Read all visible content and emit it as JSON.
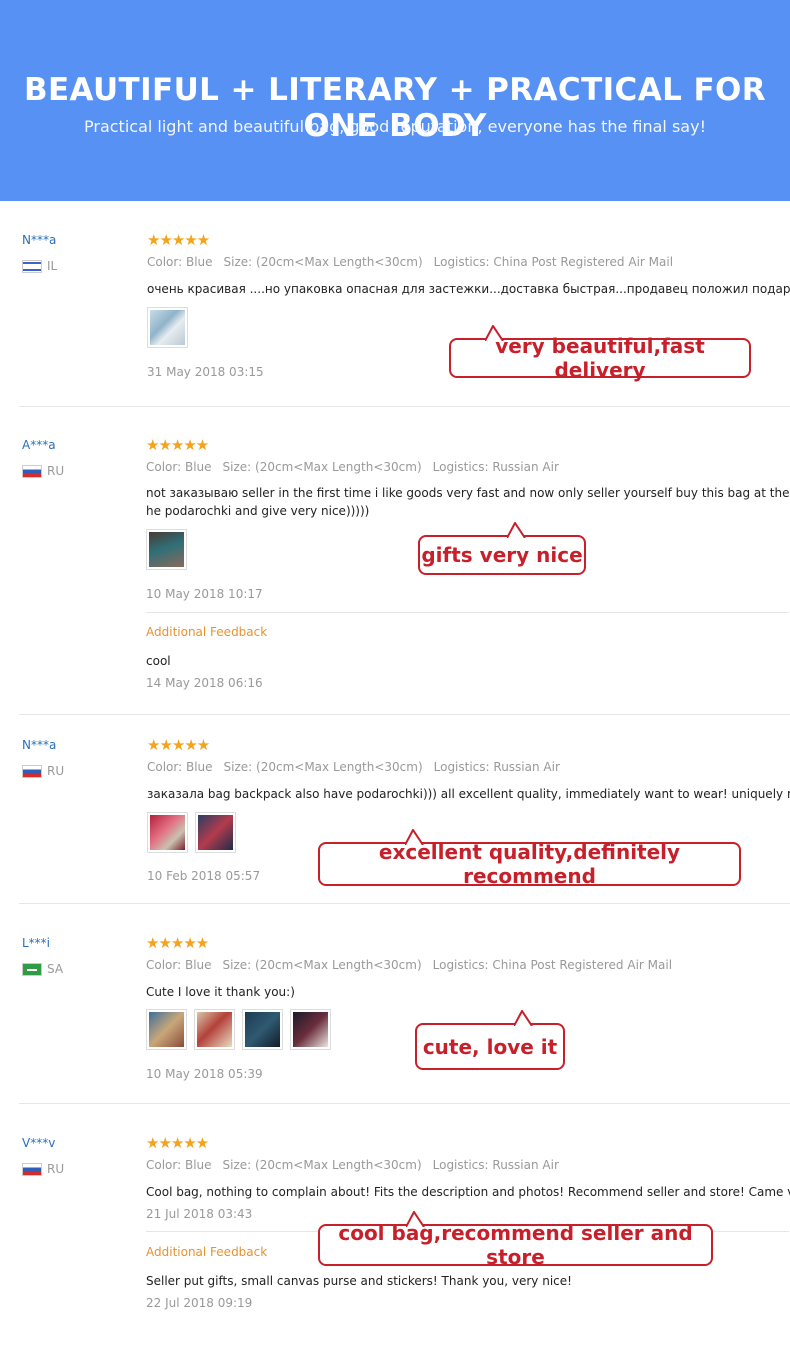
{
  "banner": {
    "title": "BEAUTIFUL + LITERARY + PRACTICAL FOR ONE BODY",
    "subtitle": "Practical light and beautiful bag, good reputation, everyone has the final say!"
  },
  "reviews": [
    {
      "user": "N***a",
      "country": "IL",
      "stars": "★★★★★",
      "color": "Color: Blue",
      "size": "Size: (20cm<Max Length<30cm)",
      "logistics": "Logistics: China Post Registered Air Mail",
      "text": "очень красивая ....но упаковка опасная для застежки...доставка быстрая...продавец положил подарочек",
      "date": "31 May 2018 03:15",
      "callout": "very beautiful,fast delivery"
    },
    {
      "user": "A***a",
      "country": "RU",
      "stars": "★★★★★",
      "color": "Color: Blue",
      "size": "Size: (20cm<Max Length<30cm)",
      "logistics": "Logistics: Russian Air",
      "text": "not заказываю seller in the first time i like goods very fast and now only seller yourself buy this bag at the he podarochki and give very nice)))))",
      "date": "10 May 2018 10:17",
      "additional_label": "Additional Feedback",
      "additional_text": "cool",
      "additional_date": "14 May 2018 06:16",
      "callout": "gifts very nice"
    },
    {
      "user": "N***a",
      "country": "RU",
      "stars": "★★★★★",
      "color": "Color: Blue",
      "size": "Size: (20cm<Max Length<30cm)",
      "logistics": "Logistics: Russian Air",
      "text": "заказала bag backpack also have podarochki))) all excellent quality, immediately want to wear! uniquely reco",
      "date": "10 Feb 2018 05:57",
      "callout": "excellent quality,definitely recommend"
    },
    {
      "user": "L***i",
      "country": "SA",
      "stars": "★★★★★",
      "color": "Color: Blue",
      "size": "Size: (20cm<Max Length<30cm)",
      "logistics": "Logistics: China Post Registered Air Mail",
      "text": "Cute I love it thank you:)",
      "date": "10 May 2018 05:39",
      "callout": "cute, love it"
    },
    {
      "user": "V***v",
      "country": "RU",
      "stars": "★★★★★",
      "color": "Color: Blue",
      "size": "Size: (20cm<Max Length<30cm)",
      "logistics": "Logistics: Russian Air",
      "text": "Cool bag, nothing to complain about! Fits the description and photos! Recommend seller and store! Came ve",
      "date": "21 Jul 2018 03:43",
      "additional_label": "Additional Feedback",
      "additional_text": "Seller put gifts, small canvas purse and stickers! Thank you, very nice!",
      "additional_date": "22 Jul 2018 09:19",
      "callout": "cool bag,recommend seller and store"
    }
  ],
  "colors": {
    "banner": "#5791f4",
    "star": "#f5a31a",
    "callout": "#c8202a",
    "username": "#2a6ebb",
    "additional": "#e7932d"
  }
}
